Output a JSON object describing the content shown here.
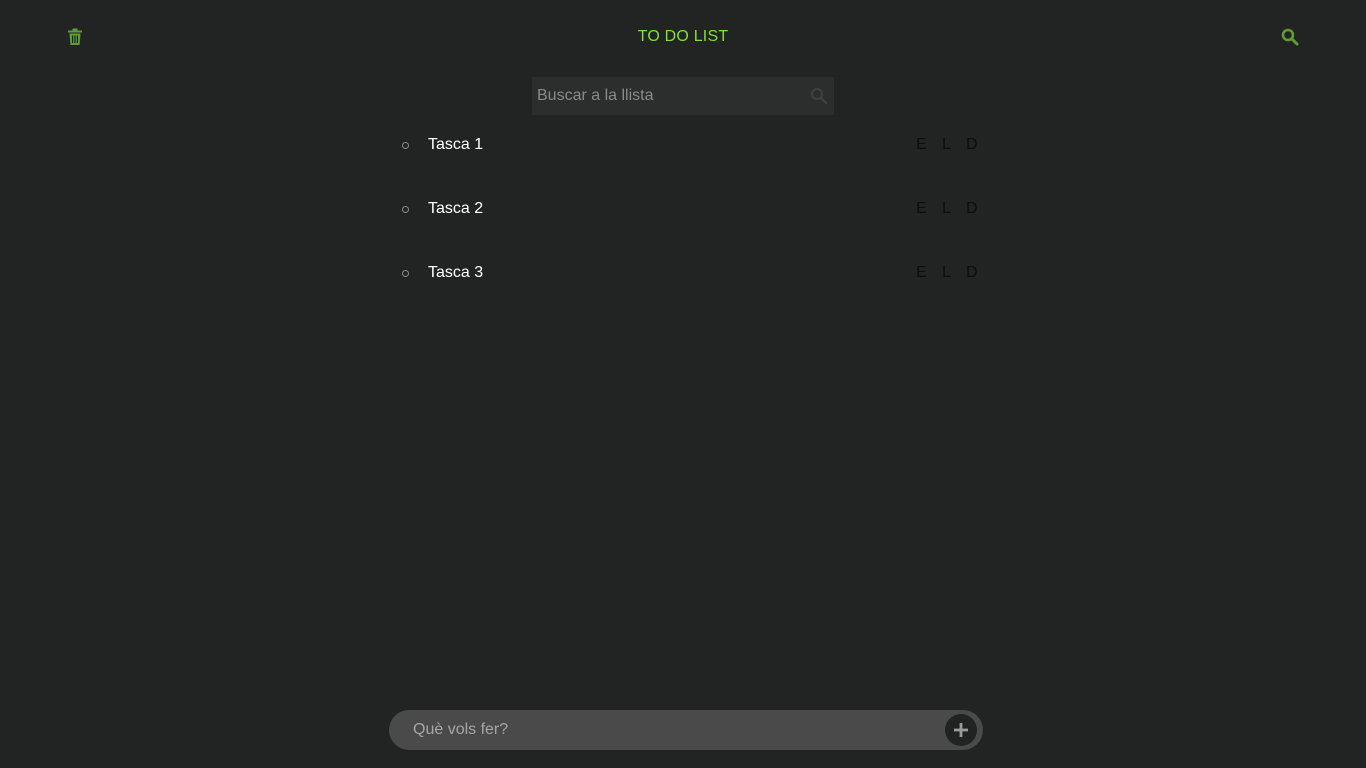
{
  "header": {
    "title": "TO DO LIST",
    "left_icon": "trash-icon",
    "right_icon": "search-icon",
    "accent_color": "#7fe03a",
    "icon_color": "#5e9c35"
  },
  "search": {
    "placeholder": "Buscar a la llista",
    "value": "",
    "icon": "search-icon"
  },
  "tasks": [
    {
      "label": "Tasca 1",
      "actions": [
        "E",
        "L",
        "D"
      ]
    },
    {
      "label": "Tasca 2",
      "actions": [
        "E",
        "L",
        "D"
      ]
    },
    {
      "label": "Tasca 3",
      "actions": [
        "E",
        "L",
        "D"
      ]
    }
  ],
  "composer": {
    "placeholder": "Què vols fer?",
    "value": "",
    "add_icon": "plus-icon"
  }
}
